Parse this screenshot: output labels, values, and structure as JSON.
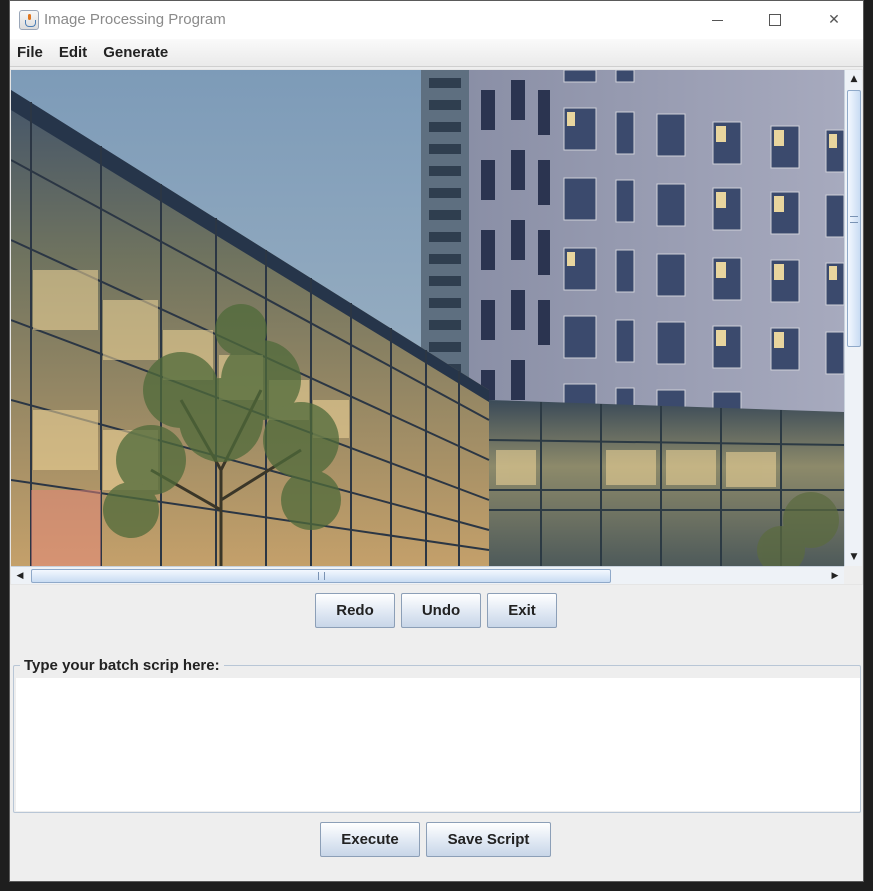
{
  "window": {
    "title": "Image Processing Program",
    "controls": {
      "minimize": "",
      "maximize": "",
      "close": "✕"
    }
  },
  "menu": {
    "items": [
      {
        "label": "File"
      },
      {
        "label": "Edit"
      },
      {
        "label": "Generate"
      }
    ]
  },
  "image_pane": {
    "image_description_icon": "photo-icon",
    "vertical_scroll": {
      "up": "▲",
      "down": "▼"
    },
    "horizontal_scroll": {
      "left": "◀",
      "right": "▶"
    }
  },
  "controls": {
    "redo_label": "Redo",
    "undo_label": "Undo",
    "exit_label": "Exit"
  },
  "script": {
    "legend": "Type your batch scrip here:",
    "value": "",
    "execute_label": "Execute",
    "save_label": "Save Script"
  },
  "colors": {
    "button_border": "#8c9fb7",
    "scroll_thumb": "#c9dcf3"
  }
}
